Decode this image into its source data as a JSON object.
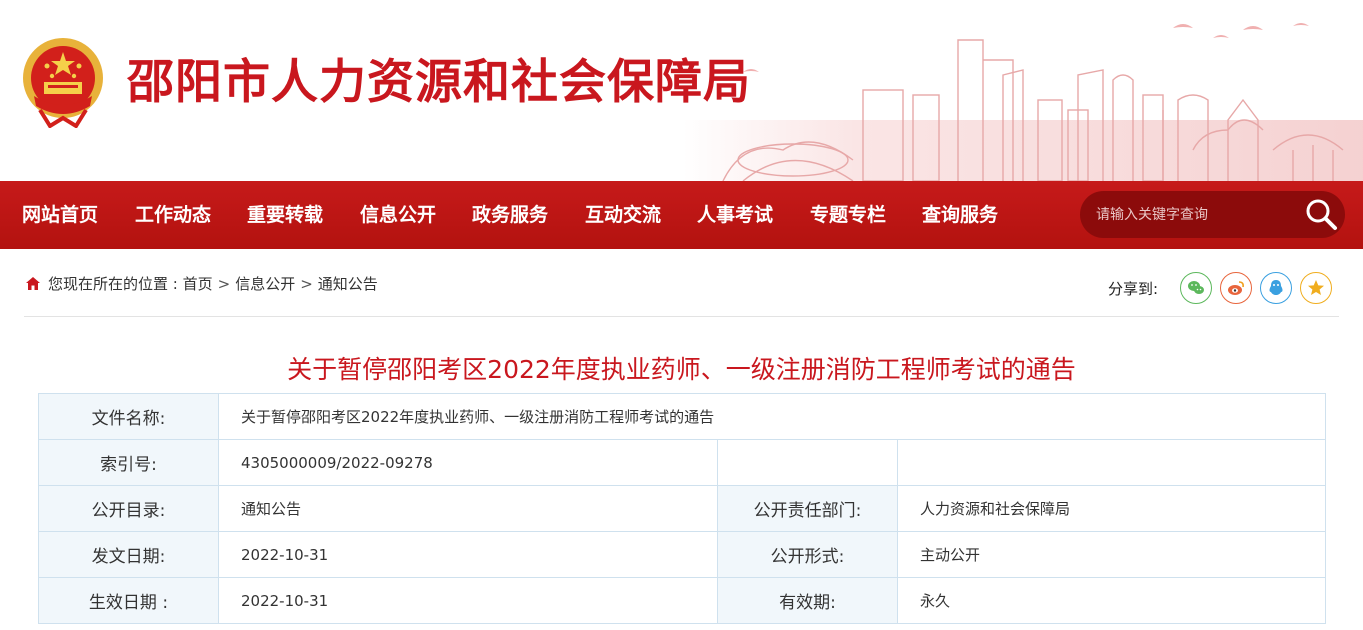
{
  "header": {
    "site_title": "邵阳市人力资源和社会保障局"
  },
  "nav": {
    "items": [
      "网站首页",
      "工作动态",
      "重要转载",
      "信息公开",
      "政务服务",
      "互动交流",
      "人事考试",
      "专题专栏",
      "查询服务"
    ]
  },
  "search": {
    "placeholder": "请输入关键字查询"
  },
  "breadcrumb": {
    "prefix": "您现在所在的位置 : ",
    "items": [
      "首页",
      "信息公开",
      "通知公告"
    ],
    "separator": ">"
  },
  "share": {
    "label": "分享到:",
    "targets": [
      {
        "name": "wechat-icon",
        "color": "#5cb85c"
      },
      {
        "name": "weibo-icon",
        "color": "#e8653c"
      },
      {
        "name": "qq-icon",
        "color": "#3aa0e0"
      },
      {
        "name": "qzone-icon",
        "color": "#f0ad1e"
      }
    ]
  },
  "article": {
    "title": "关于暂停邵阳考区2022年度执业药师、一级注册消防工程师考试的通告"
  },
  "meta": {
    "file_name_label": "文件名称:",
    "file_name": "关于暂停邵阳考区2022年度执业药师、一级注册消防工程师考试的通告",
    "index_label": "索引号:",
    "index_value": "4305000009/2022-09278",
    "catalog_label": "公开目录:",
    "catalog_value": "通知公告",
    "dept_label": "公开责任部门:",
    "dept_value": "人力资源和社会保障局",
    "issue_date_label": "发文日期:",
    "issue_date_value": "2022-10-31",
    "form_label": "公开形式:",
    "form_value": "主动公开",
    "effective_label": "生效日期 :",
    "effective_value": "2022-10-31",
    "validity_label": "有效期:",
    "validity_value": "永久"
  },
  "colors": {
    "brand_red": "#c9171e",
    "nav_red": "#bd1714",
    "search_bg": "#8c0b0b",
    "table_border": "#cfe1ee",
    "table_label_bg": "#f1f7fb"
  }
}
